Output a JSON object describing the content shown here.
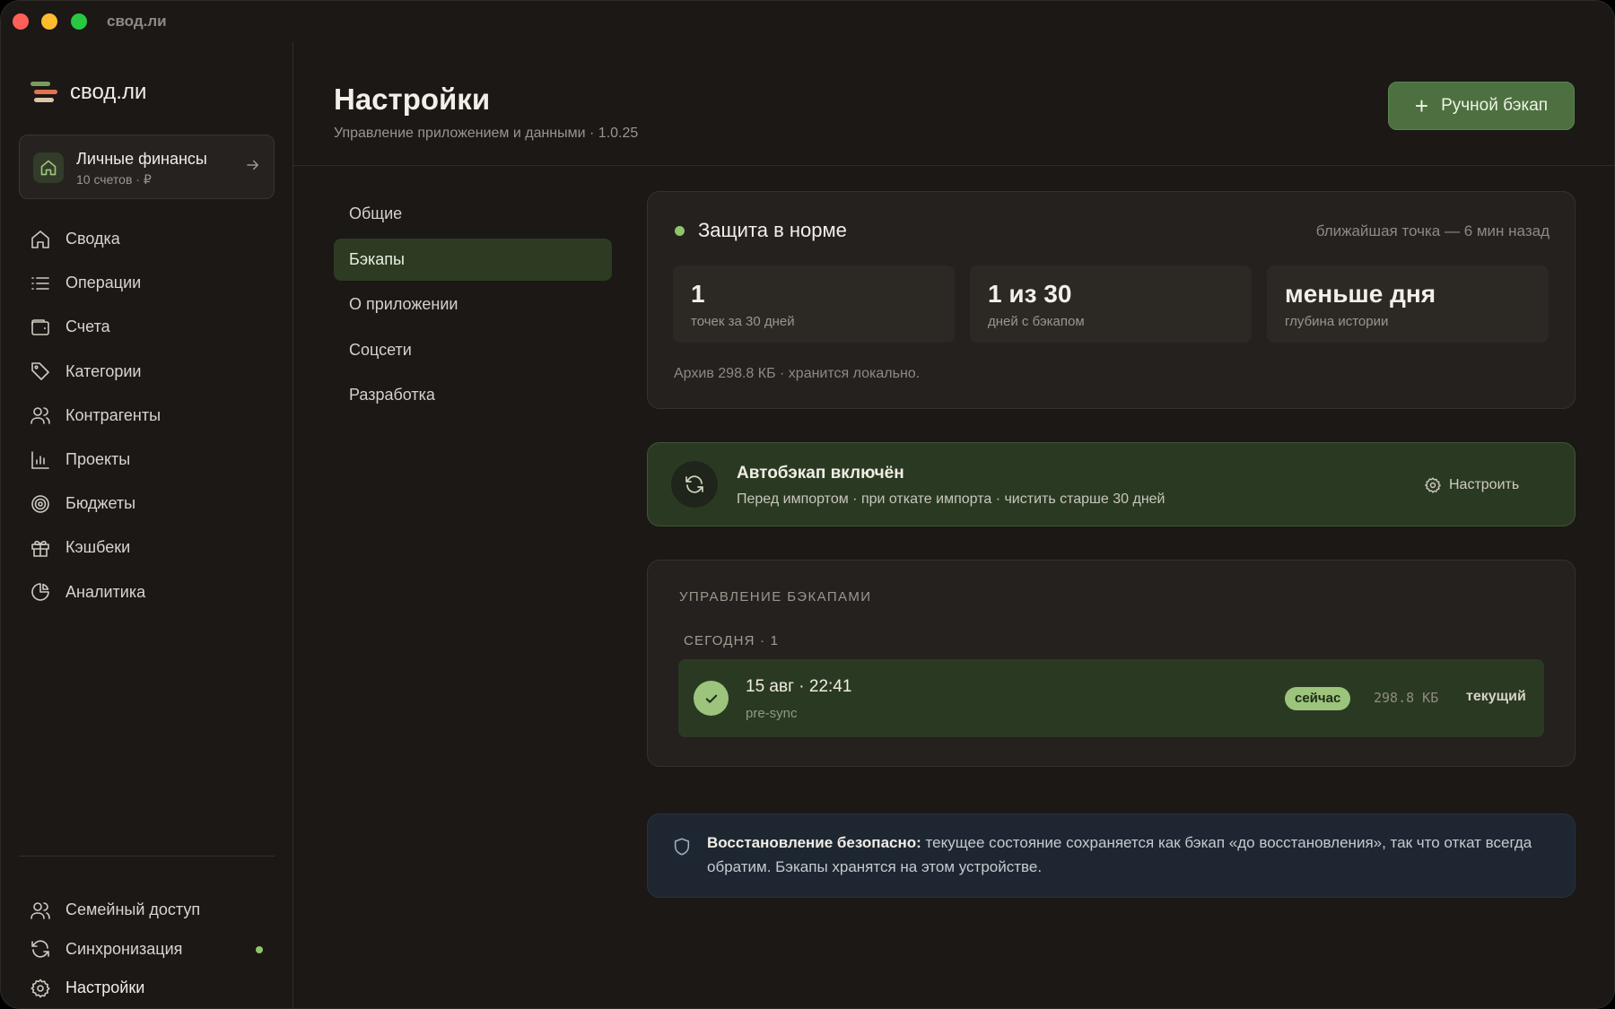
{
  "window": {
    "title": "свод.ли"
  },
  "brand": {
    "name": "свод.ли"
  },
  "workspace": {
    "title": "Личные финансы",
    "subtitle": "10 счетов · ₽"
  },
  "nav": {
    "items": [
      {
        "label": "Сводка",
        "icon": "home-icon"
      },
      {
        "label": "Операции",
        "icon": "list-icon"
      },
      {
        "label": "Счета",
        "icon": "wallet-icon"
      },
      {
        "label": "Категории",
        "icon": "tag-icon"
      },
      {
        "label": "Контрагенты",
        "icon": "users-icon"
      },
      {
        "label": "Проекты",
        "icon": "chart-bar-icon"
      },
      {
        "label": "Бюджеты",
        "icon": "target-icon"
      },
      {
        "label": "Кэшбеки",
        "icon": "gift-icon"
      },
      {
        "label": "Аналитика",
        "icon": "pie-chart-icon"
      }
    ],
    "bottom": [
      {
        "label": "Семейный доступ",
        "icon": "users-icon"
      },
      {
        "label": "Синхронизация",
        "icon": "refresh-icon"
      },
      {
        "label": "Настройки",
        "icon": "gear-icon"
      }
    ]
  },
  "header": {
    "title": "Настройки",
    "subtitle": "Управление приложением и данными · 1.0.25",
    "action_label": "Ручной бэкап"
  },
  "settings_nav": {
    "items": [
      "Общие",
      "Бэкапы",
      "О приложении",
      "Соцсети",
      "Разработка"
    ],
    "active": "Бэкапы"
  },
  "status": {
    "title": "Защита в норме",
    "meta": "ближайшая точка — 6 мин назад",
    "stats": [
      {
        "value": "1",
        "label": "точек за 30 дней"
      },
      {
        "value": "1 из 30",
        "label": "дней с бэкапом"
      },
      {
        "value": "меньше дня",
        "label": "глубина истории"
      }
    ],
    "footer": "Архив 298.8 КБ · хранится локально."
  },
  "autobackup": {
    "title": "Автобэкап включён",
    "subtitle": "Перед импортом · при откате импорта · чистить старше 30 дней",
    "action_label": "Настроить"
  },
  "manage": {
    "heading": "УПРАВЛЕНИЕ БЭКАПАМИ",
    "group": "СЕГОДНЯ · 1",
    "backups": [
      {
        "date": "15 авг · 22:41",
        "tag": "pre-sync",
        "badge": "сейчас",
        "size": "298.8 КБ",
        "state": "текущий"
      }
    ]
  },
  "info": {
    "lead": "Восстановление безопасно:",
    "text": " текущее состояние сохраняется как бэкап «до восстановления», так что откат всегда обратим. Бэкапы хранятся на этом устройстве."
  },
  "colors": {
    "accent": "#4d7040",
    "status_ok": "#8fc56b",
    "background": "#1b1816"
  }
}
